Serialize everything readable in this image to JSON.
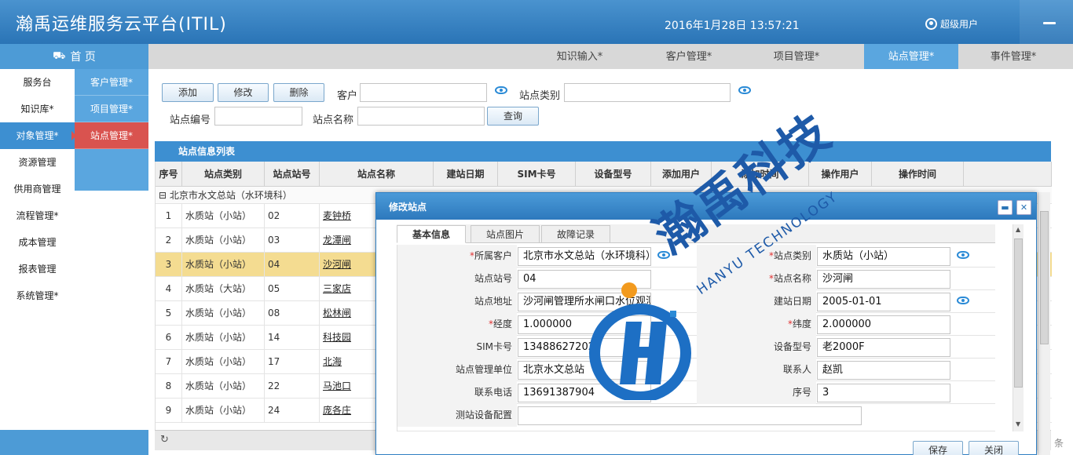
{
  "header": {
    "title": "瀚禹运维服务云平台(ITIL)",
    "datetime": "2016年1月28日 13:57:21",
    "user": "超级用户"
  },
  "nav": {
    "home": "首 页",
    "items": [
      "服务台",
      "知识库*",
      "对象管理*",
      "资源管理",
      "供用商管理",
      "流程管理*",
      "成本管理",
      "报表管理",
      "系统管理*"
    ],
    "subitems": [
      "客户管理*",
      "项目管理*",
      "站点管理*"
    ]
  },
  "tabs": [
    "知识输入*",
    "客户管理*",
    "项目管理*",
    "站点管理*",
    "事件管理*"
  ],
  "toolbar": {
    "add": "添加",
    "edit": "修改",
    "delete": "删除",
    "customer_label": "客户",
    "type_label": "站点类别",
    "code_label": "站点编号",
    "name_label": "站点名称",
    "query": "查询"
  },
  "list": {
    "title": "站点信息列表",
    "columns": [
      "序号",
      "站点类别",
      "站点站号",
      "站点名称",
      "建站日期",
      "SIM卡号",
      "设备型号",
      "添加用户",
      "添加时间",
      "操作用户",
      "操作时间"
    ],
    "group": "⊟ 北京市水文总站（水环境科）",
    "rows": [
      [
        "1",
        "水质站（小站）",
        "02",
        "麦钟桥"
      ],
      [
        "2",
        "水质站（小站）",
        "03",
        "龙潭闸"
      ],
      [
        "3",
        "水质站（小站）",
        "04",
        "沙河闸"
      ],
      [
        "4",
        "水质站（大站）",
        "05",
        "三家店"
      ],
      [
        "5",
        "水质站（小站）",
        "08",
        "松林闸"
      ],
      [
        "6",
        "水质站（小站）",
        "14",
        "科技园"
      ],
      [
        "7",
        "水质站（小站）",
        "17",
        "北海"
      ],
      [
        "8",
        "水质站（小站）",
        "22",
        "马池口"
      ],
      [
        "9",
        "水质站（小站）",
        "24",
        "庞各庄"
      ]
    ],
    "selected_index": 2,
    "footer_text": "条"
  },
  "dialog": {
    "title": "修改站点",
    "tabs": [
      "基本信息",
      "站点图片",
      "故障记录"
    ],
    "fields": {
      "customer_label": "所属客户",
      "customer": "北京市水文总站（水环境科）",
      "type_label": "站点类别",
      "type": "水质站（小站）",
      "code_label": "站点站号",
      "code": "04",
      "name_label": "站点名称",
      "name": "沙河闸",
      "address_label": "站点地址",
      "address": "沙河闸管理所水闸口水位观测",
      "date_label": "建站日期",
      "date": "2005-01-01",
      "lng_label": "经度",
      "lng": "1.000000",
      "lat_label": "纬度",
      "lat": "2.000000",
      "sim_label": "SIM卡号",
      "sim": "13488627202",
      "device_label": "设备型号",
      "device": "老2000F",
      "unit_label": "站点管理单位",
      "unit": "北京水文总站",
      "contact_label": "联系人",
      "contact": "赵凯",
      "phone_label": "联系电话",
      "phone": "13691387904",
      "seq_label": "序号",
      "seq": "3",
      "config_label": "测站设备配置",
      "config": ""
    },
    "save": "保存",
    "close": "关闭"
  },
  "watermark": {
    "text": "瀚禹科技",
    "sub": "HANYU TECHNOLOGY"
  }
}
